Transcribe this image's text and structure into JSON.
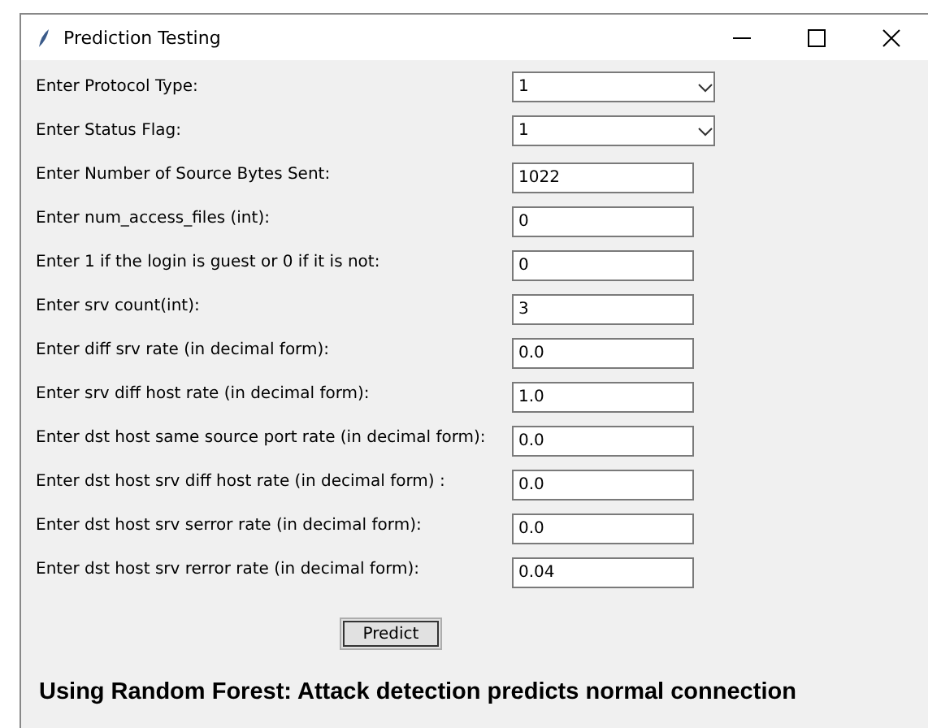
{
  "window": {
    "title": "Prediction Testing"
  },
  "fields": [
    {
      "label": "Enter Protocol Type:",
      "kind": "combo",
      "value": "1"
    },
    {
      "label": "Enter Status Flag:",
      "kind": "combo",
      "value": "1"
    },
    {
      "label": "Enter Number of Source Bytes Sent:",
      "kind": "entry",
      "value": "1022"
    },
    {
      "label": "Enter num_access_files (int):",
      "kind": "entry",
      "value": "0"
    },
    {
      "label": "Enter 1 if the login is guest or 0 if it is not:",
      "kind": "entry",
      "value": "0"
    },
    {
      "label": "Enter srv count(int):",
      "kind": "entry",
      "value": "3"
    },
    {
      "label": "Enter diff srv rate (in decimal form):",
      "kind": "entry",
      "value": "0.0"
    },
    {
      "label": "Enter srv diff host rate (in decimal form):",
      "kind": "entry",
      "value": "1.0"
    },
    {
      "label": "Enter dst host same source port rate (in decimal form):",
      "kind": "entry",
      "value": "0.0"
    },
    {
      "label": "Enter dst host srv diff host rate (in decimal form) :",
      "kind": "entry",
      "value": "0.0"
    },
    {
      "label": "Enter dst host srv serror rate (in decimal form):",
      "kind": "entry",
      "value": "0.0"
    },
    {
      "label": "Enter dst host srv rerror rate (in decimal form):",
      "kind": "entry",
      "value": "0.04"
    }
  ],
  "button": "Predict",
  "result": "Using Random Forest: Attack detection predicts normal connection"
}
